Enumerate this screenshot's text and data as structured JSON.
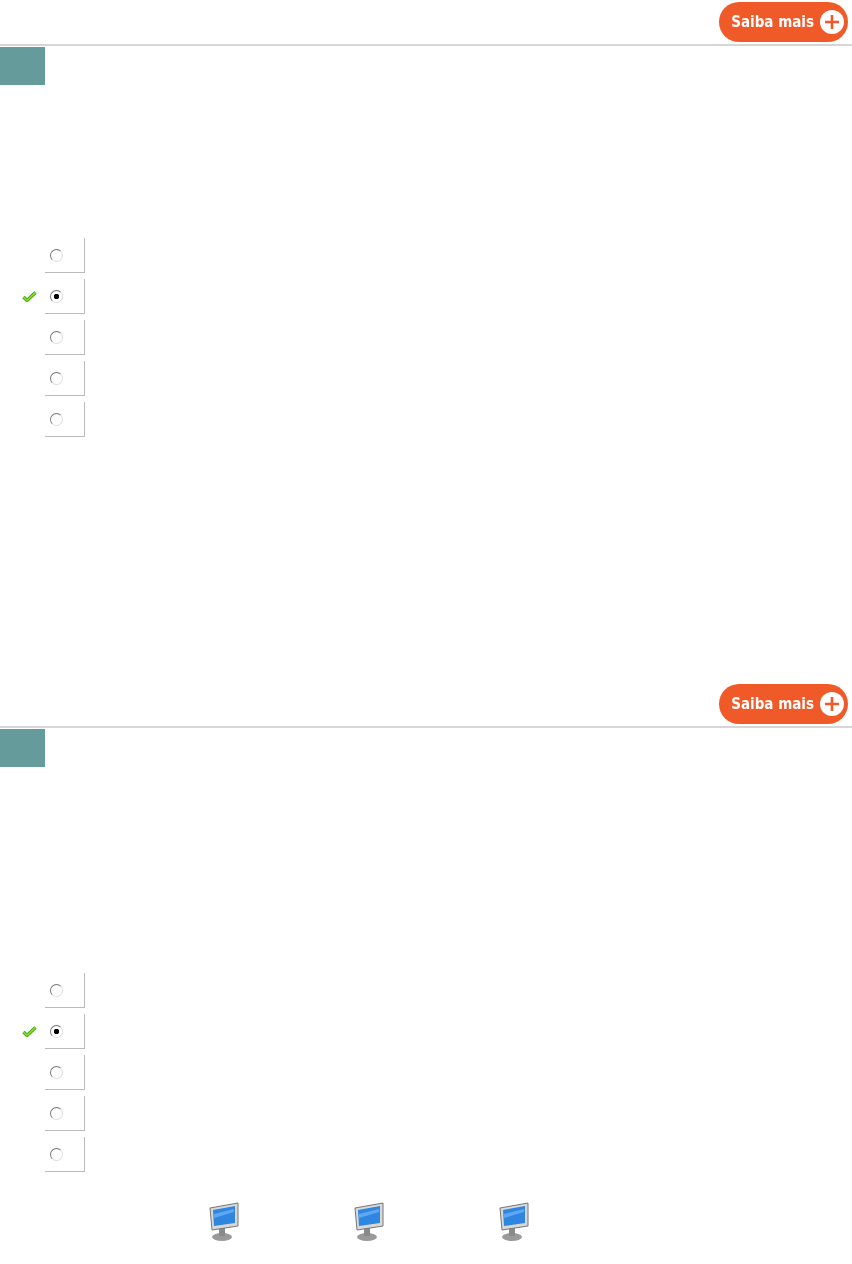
{
  "questions": [
    {
      "button": "Saiba mais",
      "options": [
        {
          "selected": false,
          "correct": false
        },
        {
          "selected": true,
          "correct": true
        },
        {
          "selected": false,
          "correct": false
        },
        {
          "selected": false,
          "correct": false
        },
        {
          "selected": false,
          "correct": false
        }
      ]
    },
    {
      "button": "Saiba mais",
      "options": [
        {
          "selected": false,
          "correct": false
        },
        {
          "selected": true,
          "correct": true
        },
        {
          "selected": false,
          "correct": false
        },
        {
          "selected": false,
          "correct": false
        },
        {
          "selected": false,
          "correct": false
        }
      ]
    }
  ]
}
